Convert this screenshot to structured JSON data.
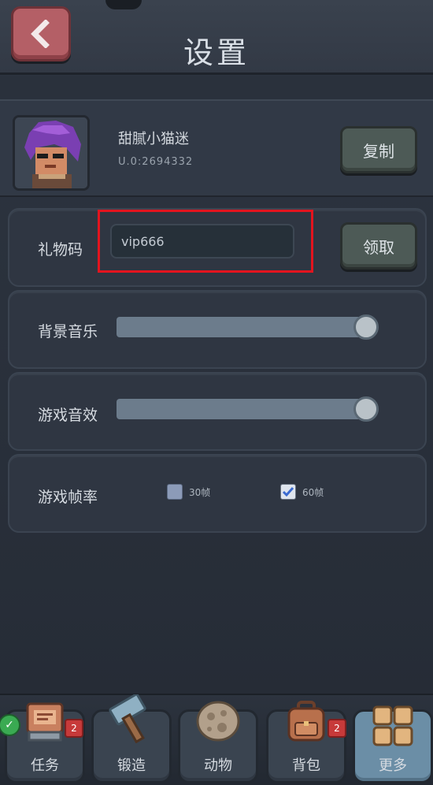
{
  "header": {
    "title": "设置"
  },
  "profile": {
    "nickname": "甜腻小猫迷",
    "uid": "U.0:2694332",
    "copy_label": "复制"
  },
  "gift": {
    "label": "礼物码",
    "input_value": "vip666",
    "claim_label": "领取"
  },
  "music": {
    "label": "背景音乐",
    "value": 1.0
  },
  "sfx": {
    "label": "游戏音效",
    "value": 1.0
  },
  "framerate": {
    "label": "游戏帧率",
    "options": [
      {
        "label": "30帧",
        "checked": false
      },
      {
        "label": "60帧",
        "checked": true
      }
    ]
  },
  "tabs": [
    {
      "label": "任务",
      "badge": "2",
      "icon": "computer-icon"
    },
    {
      "label": "锻造",
      "badge": "",
      "icon": "hammer-icon"
    },
    {
      "label": "动物",
      "badge": "",
      "icon": "rock-egg-icon"
    },
    {
      "label": "背包",
      "badge": "2",
      "icon": "backpack-icon"
    },
    {
      "label": "更多",
      "badge": "",
      "icon": "grid-icon"
    }
  ],
  "colors": {
    "highlight": "#e3141e",
    "back_button": "#b45f66",
    "active_tab": "#6b8ea6"
  }
}
